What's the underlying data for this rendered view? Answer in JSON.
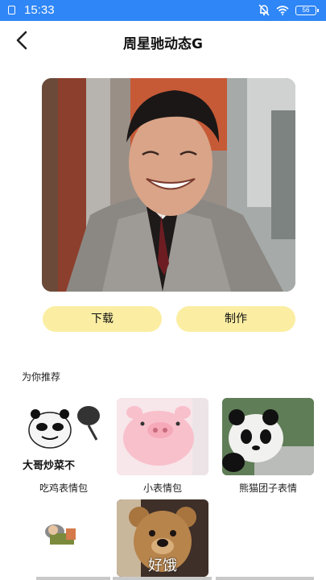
{
  "status_bar": {
    "time": "15:33",
    "battery": "56"
  },
  "header": {
    "title": "周星驰动态G"
  },
  "actions": {
    "download_label": "下载",
    "make_label": "制作"
  },
  "recommend": {
    "title": "为你推荐",
    "items": [
      {
        "caption": "吃鸡表情包",
        "image_text": "大哥炒菜不"
      },
      {
        "caption": "小表情包"
      },
      {
        "caption": "熊猫团子表情"
      },
      {
        "caption": ""
      },
      {
        "caption": "",
        "image_text": "好饿"
      }
    ]
  },
  "colors": {
    "status_bar": "#2f86f6",
    "button_bg": "#fbeea3"
  }
}
